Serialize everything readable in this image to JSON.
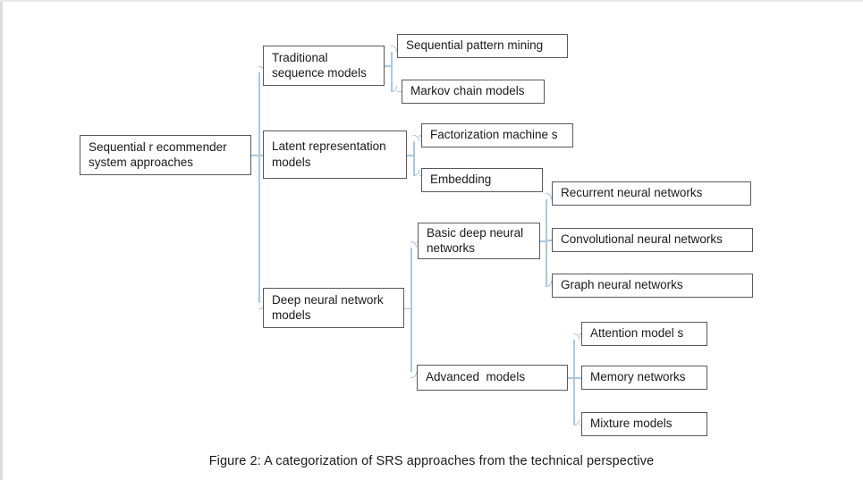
{
  "figure": {
    "caption": "Figure 2: A categorization of SRS approaches from the technical perspective",
    "connector_color": "#a9c9e2",
    "node_border_color": "#595959",
    "background_color": "#ffffff"
  },
  "nodes": {
    "root": {
      "label": "Sequential r ecommender\nsystem approaches"
    },
    "level2": [
      {
        "label": "Traditional\nsequence models"
      },
      {
        "label": "Latent representation\nmodels"
      },
      {
        "label": "Deep neural network\nmodels"
      }
    ],
    "traditional_children": [
      {
        "label": "Sequential pattern mining"
      },
      {
        "label": "Markov chain models"
      }
    ],
    "latent_children": [
      {
        "label": "Factorization machine s"
      },
      {
        "label": "Embedding"
      }
    ],
    "dnn_children": [
      {
        "label": "Basic deep neural\nnetworks"
      },
      {
        "label": "Advanced  models"
      }
    ],
    "basic_dnn_children": [
      {
        "label": "Recurrent neural networks"
      },
      {
        "label": "Convolutional neural networks"
      },
      {
        "label": "Graph neural networks"
      }
    ],
    "advanced_children": [
      {
        "label": "Attention model s"
      },
      {
        "label": "Memory networks"
      },
      {
        "label": "Mixture models"
      }
    ]
  },
  "chart_data": {
    "type": "table",
    "title": "A categorization of SRS approaches from the technical perspective",
    "root": "Sequential r ecommender system approaches",
    "hierarchy": [
      {
        "name": "Traditional sequence models",
        "children": [
          {
            "name": "Sequential pattern mining"
          },
          {
            "name": "Markov chain models"
          }
        ]
      },
      {
        "name": "Latent representation models",
        "children": [
          {
            "name": "Factorization machine s"
          },
          {
            "name": "Embedding"
          }
        ]
      },
      {
        "name": "Deep neural network models",
        "children": [
          {
            "name": "Basic deep neural networks",
            "children": [
              {
                "name": "Recurrent neural networks"
              },
              {
                "name": "Convolutional neural networks"
              },
              {
                "name": "Graph neural networks"
              }
            ]
          },
          {
            "name": "Advanced  models",
            "children": [
              {
                "name": "Attention model s"
              },
              {
                "name": "Memory networks"
              },
              {
                "name": "Mixture models"
              }
            ]
          }
        ]
      }
    ],
    "depth": 4,
    "node_count": 15
  }
}
